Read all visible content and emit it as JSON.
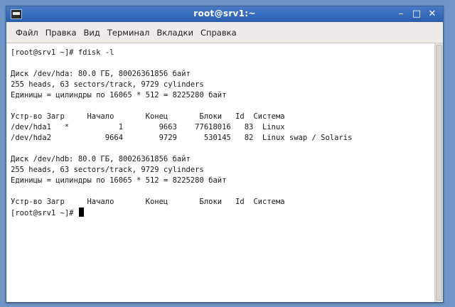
{
  "window": {
    "title": "root@srv1:~",
    "controls": {
      "minimize": "–",
      "maximize": "□",
      "close": "✕"
    }
  },
  "menubar": {
    "items": [
      {
        "label": "Файл"
      },
      {
        "label": "Правка"
      },
      {
        "label": "Вид"
      },
      {
        "label": "Терминал"
      },
      {
        "label": "Вкладки"
      },
      {
        "label": "Справка"
      }
    ]
  },
  "terminal": {
    "lines": [
      "[root@srv1 ~]# fdisk -l",
      "",
      "Диск /dev/hda: 80.0 ГБ, 80026361856 байт",
      "255 heads, 63 sectors/track, 9729 cylinders",
      "Единицы = цилиндры по 16065 * 512 = 8225280 байт",
      "",
      "Устр-во Загр     Начало       Конец       Блоки   Id  Система",
      "/dev/hda1   *           1        9663    77618016   83  Linux",
      "/dev/hda2            9664        9729      530145   82  Linux swap / Solaris",
      "",
      "Диск /dev/hdb: 80.0 ГБ, 80026361856 байт",
      "255 heads, 63 sectors/track, 9729 cylinders",
      "Единицы = цилиндры по 16065 * 512 = 8225280 байт",
      "",
      "Устр-во Загр     Начало       Конец       Блоки   Id  Система"
    ],
    "prompt": "[root@srv1 ~]# "
  },
  "colors": {
    "desktop": "#6f95c8",
    "titlebar": "#356bbd",
    "menubar": "#efece7",
    "terminal_bg": "#ffffff",
    "terminal_fg": "#1a1a1a"
  }
}
